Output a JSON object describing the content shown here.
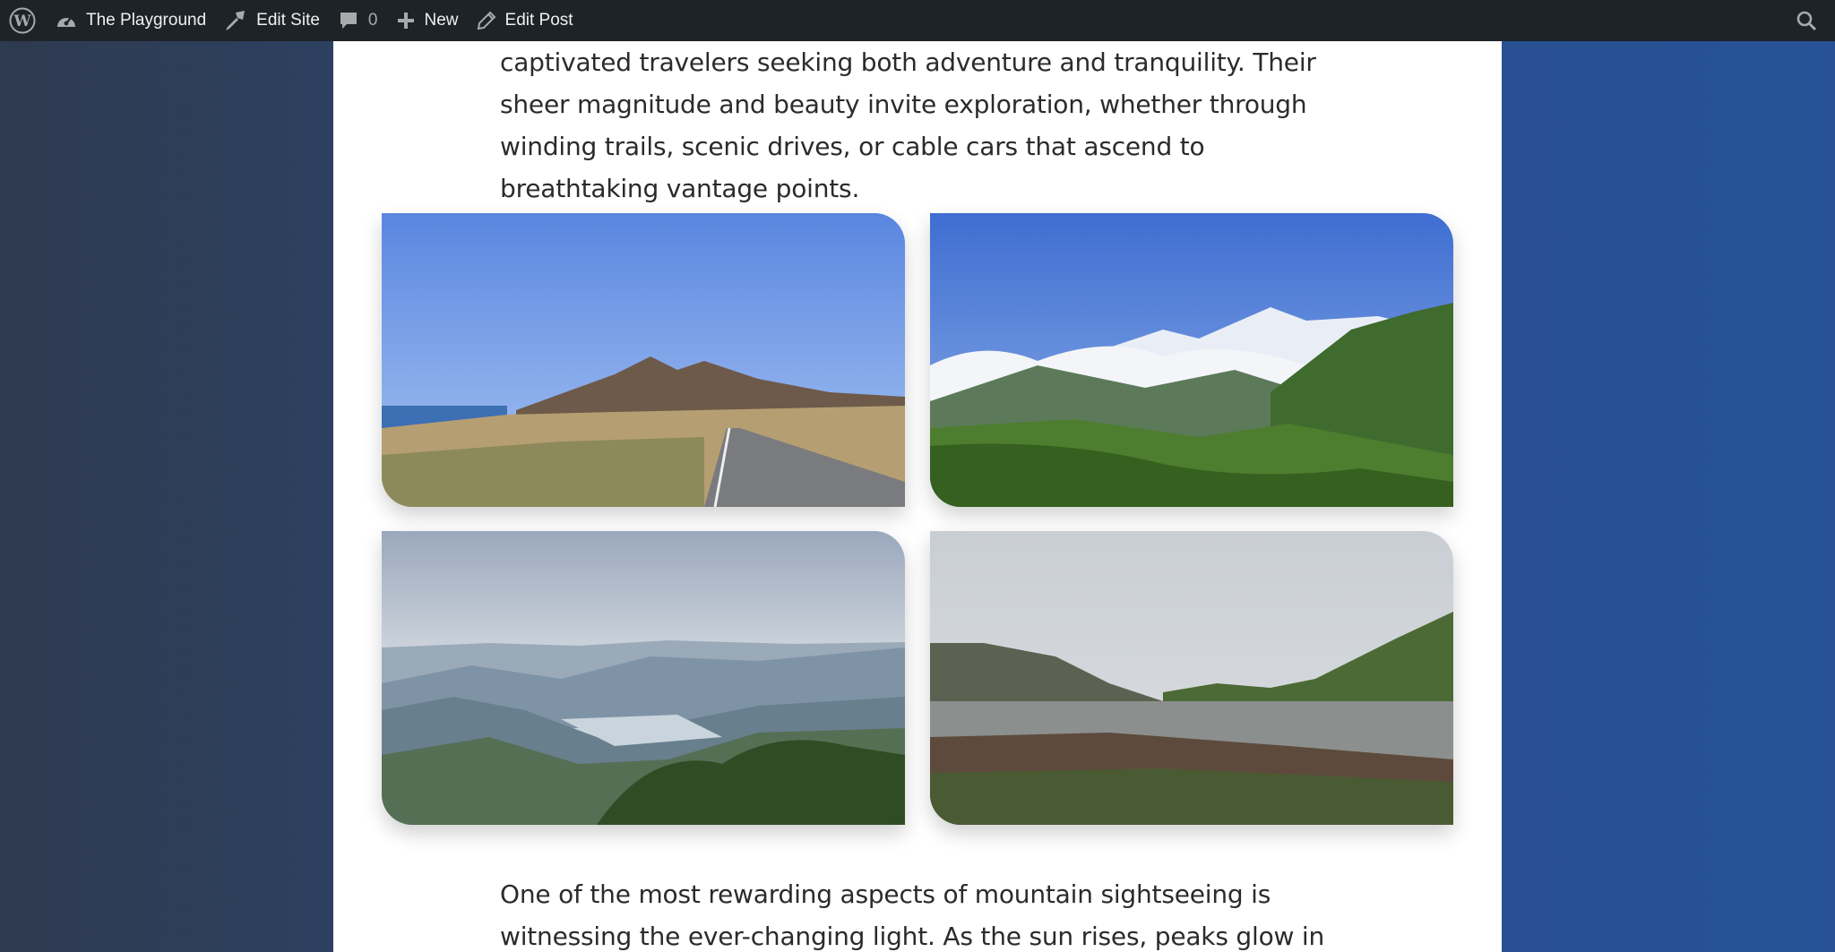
{
  "admin_bar": {
    "site_name": "The Playground",
    "edit_site": "Edit Site",
    "comments_count": "0",
    "new_label": "New",
    "edit_post": "Edit Post",
    "icons": [
      "wordpress-logo-icon",
      "dashboard-icon",
      "brush-icon",
      "comment-icon",
      "plus-icon",
      "pencil-icon",
      "search-icon"
    ]
  },
  "content": {
    "paragraph_top": "captivated travelers seeking both adventure and tranquility. Their sheer magnitude and beauty invite exploration, whether through winding trails, scenic drives, or cable cars that ascend to breathtaking vantage points.",
    "paragraph_bottom": "One of the most rewarding aspects of mountain sightseeing is witnessing the ever-changing light. As the sun rises, peaks glow in shades of gold"
  },
  "colors": {
    "admin_bar": "#1d2327",
    "page_bg": "#ffffff",
    "text": "#2b2b2b",
    "backdrop_left": "#2e3a4f",
    "backdrop_right": "#275297"
  }
}
